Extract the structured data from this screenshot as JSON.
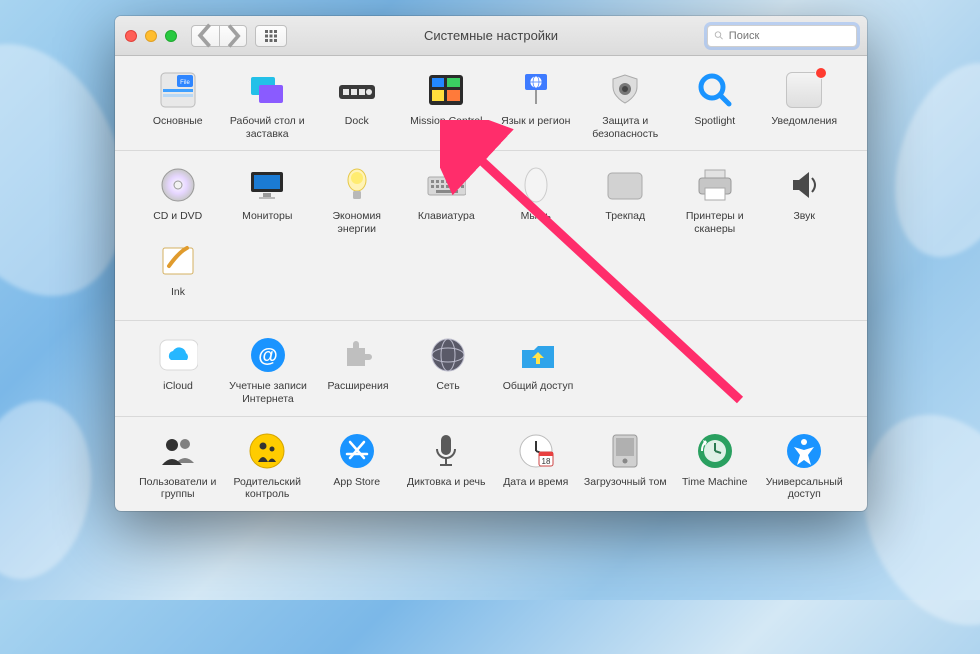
{
  "window": {
    "title": "Системные настройки"
  },
  "search": {
    "placeholder": "Поиск"
  },
  "sections": [
    {
      "items": [
        {
          "id": "general",
          "label": "Основные"
        },
        {
          "id": "desktop",
          "label": "Рабочий стол и заставка"
        },
        {
          "id": "dock",
          "label": "Dock"
        },
        {
          "id": "mission",
          "label": "Mission Control"
        },
        {
          "id": "language",
          "label": "Язык и регион"
        },
        {
          "id": "security",
          "label": "Защита и безопасность"
        },
        {
          "id": "spotlight",
          "label": "Spotlight"
        },
        {
          "id": "notifications",
          "label": "Уведомления",
          "badge": true
        }
      ]
    },
    {
      "items": [
        {
          "id": "cddvd",
          "label": "CD и DVD"
        },
        {
          "id": "displays",
          "label": "Мониторы"
        },
        {
          "id": "energy",
          "label": "Экономия энергии"
        },
        {
          "id": "keyboard",
          "label": "Клавиатура"
        },
        {
          "id": "mouse",
          "label": "Мышь"
        },
        {
          "id": "trackpad",
          "label": "Трекпад"
        },
        {
          "id": "printers",
          "label": "Принтеры и сканеры"
        },
        {
          "id": "sound",
          "label": "Звук"
        }
      ],
      "items2": [
        {
          "id": "ink",
          "label": "Ink"
        }
      ]
    },
    {
      "items": [
        {
          "id": "icloud",
          "label": "iCloud"
        },
        {
          "id": "accounts",
          "label": "Учетные записи Интернета"
        },
        {
          "id": "extensions",
          "label": "Расширения"
        },
        {
          "id": "network",
          "label": "Сеть"
        },
        {
          "id": "sharing",
          "label": "Общий доступ"
        }
      ]
    },
    {
      "items": [
        {
          "id": "users",
          "label": "Пользователи и группы"
        },
        {
          "id": "parental",
          "label": "Родительский контроль"
        },
        {
          "id": "appstore",
          "label": "App Store"
        },
        {
          "id": "dictation",
          "label": "Диктовка и речь"
        },
        {
          "id": "datetime",
          "label": "Дата и время"
        },
        {
          "id": "startup",
          "label": "Загрузочный том"
        },
        {
          "id": "timemachine",
          "label": "Time Machine"
        },
        {
          "id": "accessibility",
          "label": "Универсальный доступ"
        }
      ]
    }
  ],
  "annotation": {
    "points_to": "mission"
  }
}
